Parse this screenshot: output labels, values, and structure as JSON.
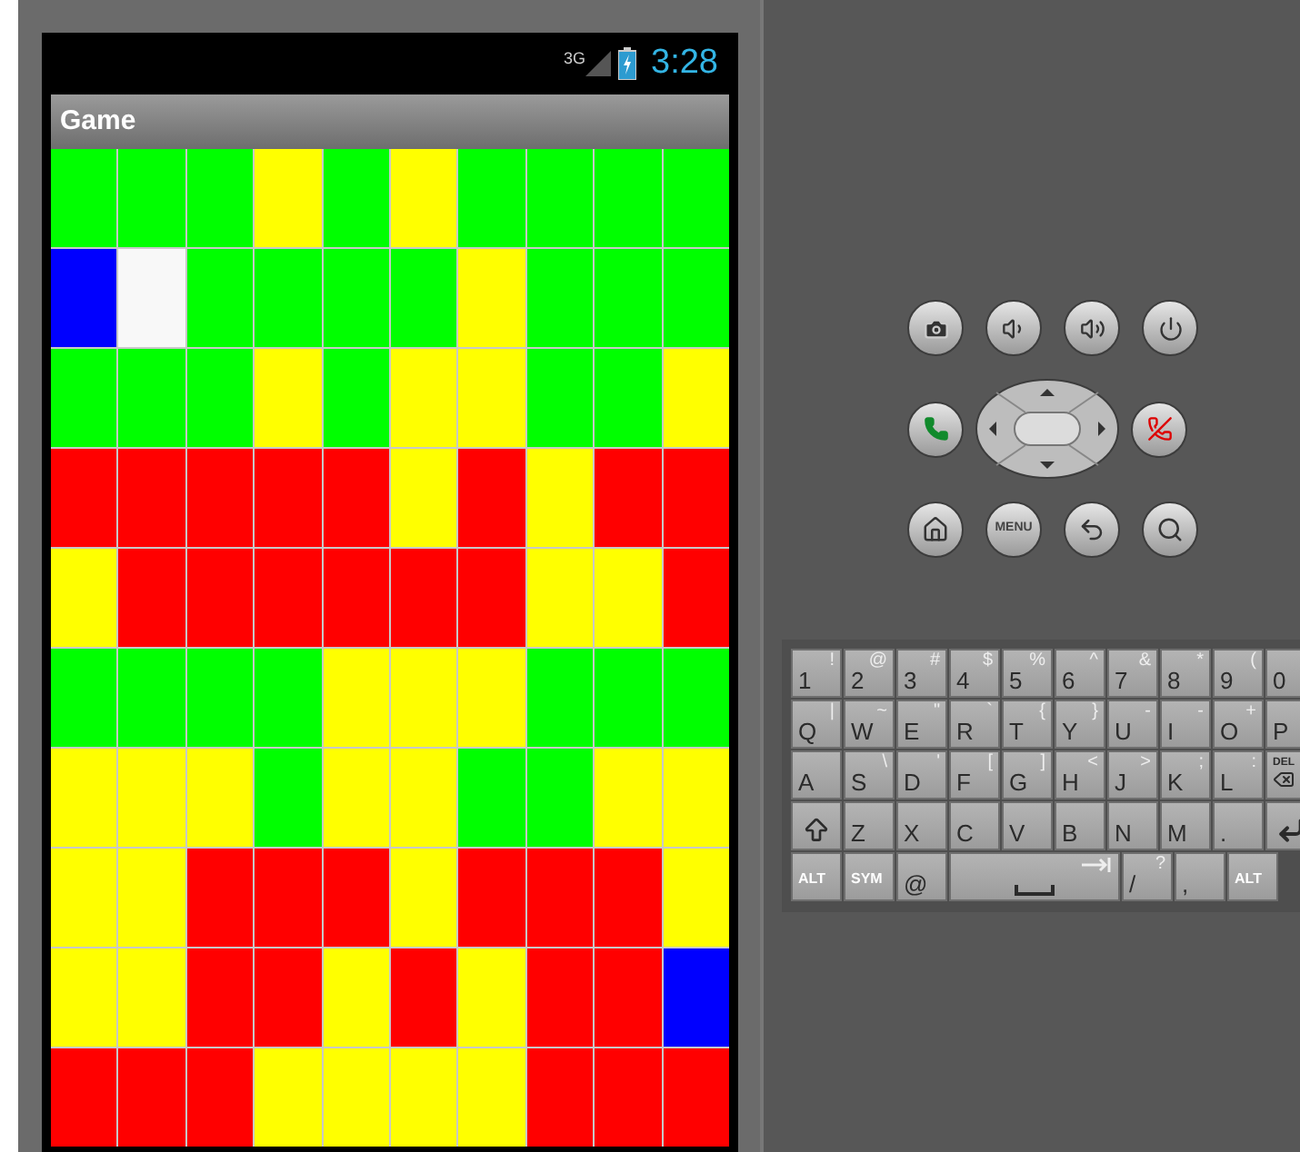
{
  "status_bar": {
    "network": "3G",
    "time": "3:28"
  },
  "window": {
    "title": "Game"
  },
  "board": [
    [
      {
        "color": "#00ff00"
      },
      {
        "color": "#00ff00"
      },
      {
        "color": "#00ff00"
      },
      {
        "color": "#ffff00"
      },
      {
        "color": "#00ff00"
      },
      {
        "color": "#ffff00"
      },
      {
        "color": "#00ff00"
      },
      {
        "color": "#00ff00"
      },
      {
        "color": "#00ff00"
      },
      {
        "color": "#00ff00"
      }
    ],
    [
      {
        "color": "#0000ff"
      },
      {
        "color": "#f8f8f8"
      },
      {
        "color": "#00ff00"
      },
      {
        "color": "#00ff00"
      },
      {
        "color": "#00ff00"
      },
      {
        "color": "#00ff00"
      },
      {
        "color": "#ffff00"
      },
      {
        "color": "#00ff00"
      },
      {
        "color": "#00ff00"
      },
      {
        "color": "#00ff00"
      }
    ],
    [
      {
        "color": "#00ff00"
      },
      {
        "color": "#00ff00"
      },
      {
        "color": "#00ff00"
      },
      {
        "color": "#ffff00"
      },
      {
        "color": "#00ff00"
      },
      {
        "color": "#ffff00"
      },
      {
        "color": "#ffff00"
      },
      {
        "color": "#00ff00"
      },
      {
        "color": "#00ff00"
      },
      {
        "color": "#ffff00"
      }
    ],
    [
      {
        "color": "#ff0000"
      },
      {
        "color": "#ff0000"
      },
      {
        "color": "#ff0000"
      },
      {
        "color": "#ff0000"
      },
      {
        "color": "#ff0000"
      },
      {
        "color": "#ffff00"
      },
      {
        "color": "#ff0000"
      },
      {
        "color": "#ffff00"
      },
      {
        "color": "#ff0000"
      },
      {
        "color": "#ff0000"
      }
    ],
    [
      {
        "color": "#ffff00"
      },
      {
        "color": "#ff0000"
      },
      {
        "color": "#ff0000"
      },
      {
        "color": "#ff0000"
      },
      {
        "color": "#ff0000"
      },
      {
        "color": "#ff0000"
      },
      {
        "color": "#ff0000"
      },
      {
        "color": "#ffff00"
      },
      {
        "color": "#ffff00"
      },
      {
        "color": "#ff0000"
      }
    ],
    [
      {
        "color": "#00ff00"
      },
      {
        "color": "#00ff00"
      },
      {
        "color": "#00ff00"
      },
      {
        "color": "#00ff00"
      },
      {
        "color": "#ffff00"
      },
      {
        "color": "#ffff00"
      },
      {
        "color": "#ffff00"
      },
      {
        "color": "#00ff00"
      },
      {
        "color": "#00ff00"
      },
      {
        "color": "#00ff00"
      }
    ],
    [
      {
        "color": "#ffff00"
      },
      {
        "color": "#ffff00"
      },
      {
        "color": "#ffff00"
      },
      {
        "color": "#00ff00"
      },
      {
        "color": "#ffff00"
      },
      {
        "color": "#ffff00"
      },
      {
        "color": "#00ff00"
      },
      {
        "color": "#00ff00"
      },
      {
        "color": "#ffff00"
      },
      {
        "color": "#ffff00"
      }
    ],
    [
      {
        "color": "#ffff00"
      },
      {
        "color": "#ffff00"
      },
      {
        "color": "#ff0000"
      },
      {
        "color": "#ff0000"
      },
      {
        "color": "#ff0000"
      },
      {
        "color": "#ffff00"
      },
      {
        "color": "#ff0000"
      },
      {
        "color": "#ff0000"
      },
      {
        "color": "#ff0000"
      },
      {
        "color": "#ffff00"
      }
    ],
    [
      {
        "color": "#ffff00"
      },
      {
        "color": "#ffff00"
      },
      {
        "color": "#ff0000"
      },
      {
        "color": "#ff0000"
      },
      {
        "color": "#ffff00"
      },
      {
        "color": "#ff0000"
      },
      {
        "color": "#ffff00"
      },
      {
        "color": "#ff0000"
      },
      {
        "color": "#ff0000"
      },
      {
        "color": "#0000ff"
      }
    ],
    [
      {
        "color": "#ff0000"
      },
      {
        "color": "#ff0000"
      },
      {
        "color": "#ff0000"
      },
      {
        "color": "#ffff00"
      },
      {
        "color": "#ffff00"
      },
      {
        "color": "#ffff00"
      },
      {
        "color": "#ffff00"
      },
      {
        "color": "#ff0000"
      },
      {
        "color": "#ff0000"
      },
      {
        "color": "#ff0000"
      }
    ]
  ],
  "hardware_buttons": {
    "menu_label": "MENU"
  },
  "keyboard": [
    [
      {
        "kind": "char",
        "label": "1",
        "alt": "!"
      },
      {
        "kind": "char",
        "label": "2",
        "alt": "@"
      },
      {
        "kind": "char",
        "label": "3",
        "alt": "#"
      },
      {
        "kind": "char",
        "label": "4",
        "alt": "$"
      },
      {
        "kind": "char",
        "label": "5",
        "alt": "%"
      },
      {
        "kind": "char",
        "label": "6",
        "alt": "^"
      },
      {
        "kind": "char",
        "label": "7",
        "alt": "&"
      },
      {
        "kind": "char",
        "label": "8",
        "alt": "*"
      },
      {
        "kind": "char",
        "label": "9",
        "alt": "("
      },
      {
        "kind": "char",
        "label": "0"
      }
    ],
    [
      {
        "kind": "char",
        "label": "Q",
        "alt": "|"
      },
      {
        "kind": "char",
        "label": "W",
        "alt": "~"
      },
      {
        "kind": "char",
        "label": "E",
        "alt": "\""
      },
      {
        "kind": "char",
        "label": "R",
        "alt": "`"
      },
      {
        "kind": "char",
        "label": "T",
        "alt": "{"
      },
      {
        "kind": "char",
        "label": "Y",
        "alt": "}"
      },
      {
        "kind": "char",
        "label": "U",
        "alt": "-"
      },
      {
        "kind": "char",
        "label": "I",
        "alt": "-"
      },
      {
        "kind": "char",
        "label": "O",
        "alt": "+"
      },
      {
        "kind": "char",
        "label": "P"
      }
    ],
    [
      {
        "kind": "char",
        "label": "A"
      },
      {
        "kind": "char",
        "label": "S",
        "alt": "\\"
      },
      {
        "kind": "char",
        "label": "D",
        "alt": "'"
      },
      {
        "kind": "char",
        "label": "F",
        "alt": "["
      },
      {
        "kind": "char",
        "label": "G",
        "alt": "]"
      },
      {
        "kind": "char",
        "label": "H",
        "alt": "<"
      },
      {
        "kind": "char",
        "label": "J",
        "alt": ">"
      },
      {
        "kind": "char",
        "label": "K",
        "alt": ";"
      },
      {
        "kind": "char",
        "label": "L",
        "alt": ":"
      },
      {
        "kind": "del",
        "label": "DEL"
      }
    ],
    [
      {
        "kind": "shift"
      },
      {
        "kind": "char",
        "label": "Z"
      },
      {
        "kind": "char",
        "label": "X"
      },
      {
        "kind": "char",
        "label": "C"
      },
      {
        "kind": "char",
        "label": "V"
      },
      {
        "kind": "char",
        "label": "B"
      },
      {
        "kind": "char",
        "label": "N"
      },
      {
        "kind": "char",
        "label": "M"
      },
      {
        "kind": "char",
        "label": "."
      },
      {
        "kind": "enter"
      }
    ],
    [
      {
        "kind": "mod",
        "label": "ALT"
      },
      {
        "kind": "mod",
        "label": "SYM"
      },
      {
        "kind": "char",
        "label": "@"
      },
      {
        "kind": "space"
      },
      {
        "kind": "char",
        "label": "/",
        "alt": "?"
      },
      {
        "kind": "char",
        "label": ","
      },
      {
        "kind": "mod",
        "label": "ALT"
      }
    ]
  ]
}
